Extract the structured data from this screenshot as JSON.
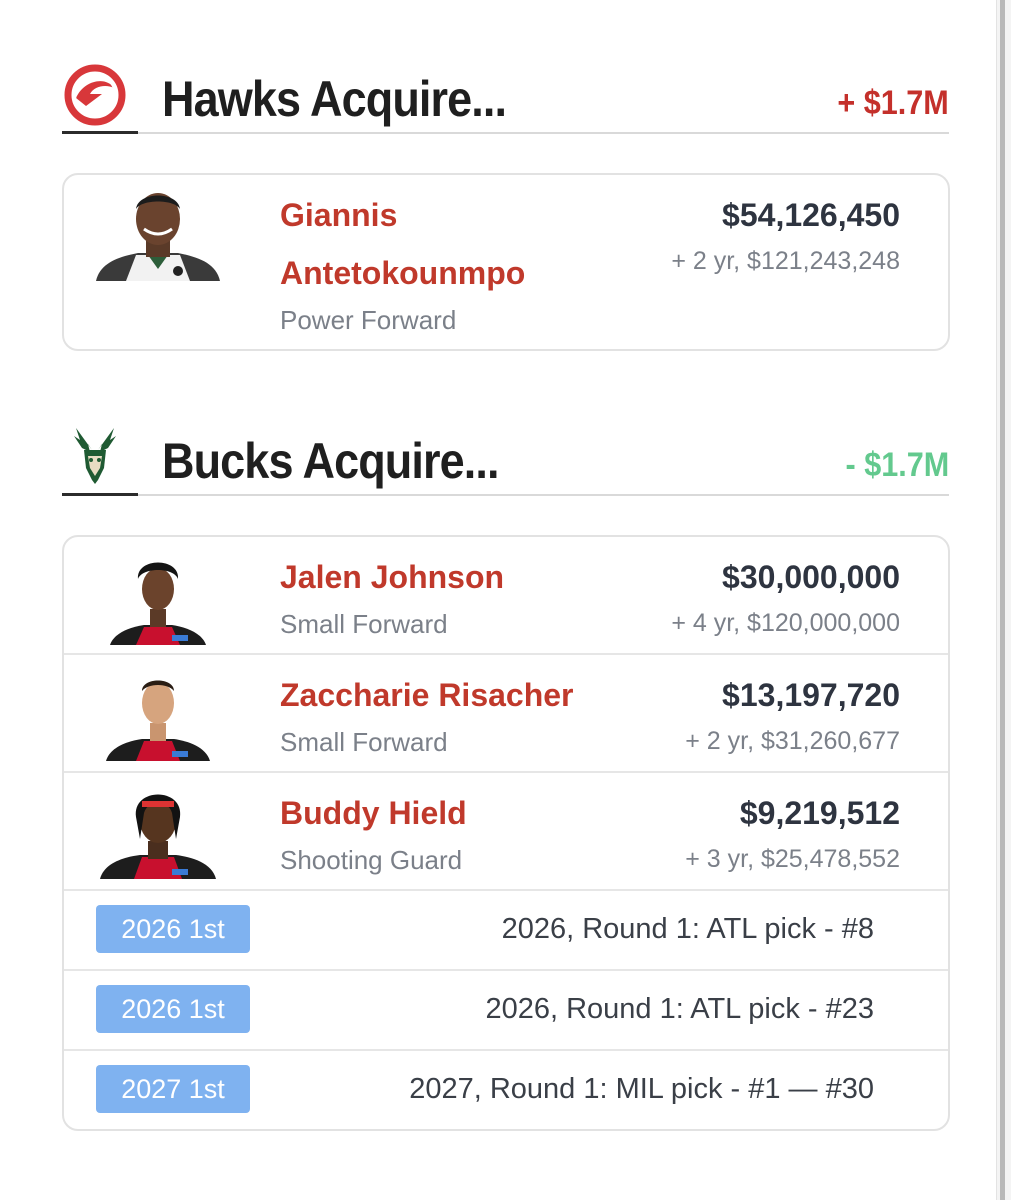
{
  "sections": [
    {
      "team": "Hawks",
      "logo_icon": "hawks-logo",
      "title": "Hawks Acquire...",
      "cap_change": "+ $1.7M",
      "cap_color": "#c4302b",
      "players": [
        {
          "name_line1": "Giannis",
          "name_line2": "Antetokounmpo",
          "position": "Power Forward",
          "salary": "$54,126,450",
          "contract": "+ 2 yr, $121,243,248",
          "jersey": "bucks-white"
        }
      ],
      "picks": []
    },
    {
      "team": "Bucks",
      "logo_icon": "bucks-logo",
      "title": "Bucks Acquire...",
      "cap_change": "- $1.7M",
      "cap_color": "#63c98e",
      "players": [
        {
          "name": "Jalen Johnson",
          "position": "Small Forward",
          "salary": "$30,000,000",
          "contract": "+ 4 yr, $120,000,000",
          "jersey": "hawks-black"
        },
        {
          "name": "Zaccharie Risacher",
          "position": "Small Forward",
          "salary": "$13,197,720",
          "contract": "+ 2 yr, $31,260,677",
          "jersey": "hawks-black"
        },
        {
          "name": "Buddy Hield",
          "position": "Shooting Guard",
          "salary": "$9,219,512",
          "contract": "+ 3 yr, $25,478,552",
          "jersey": "hawks-black"
        }
      ],
      "picks": [
        {
          "badge": "2026 1st",
          "description": "2026, Round 1: ATL pick - #8"
        },
        {
          "badge": "2026 1st",
          "description": "2026, Round 1: ATL pick - #23"
        },
        {
          "badge": "2027 1st",
          "description": "2027, Round 1: MIL pick - #1 — #30"
        }
      ]
    }
  ],
  "colors": {
    "player_name": "#c0392b",
    "pick_badge": "#7fb2f0"
  }
}
